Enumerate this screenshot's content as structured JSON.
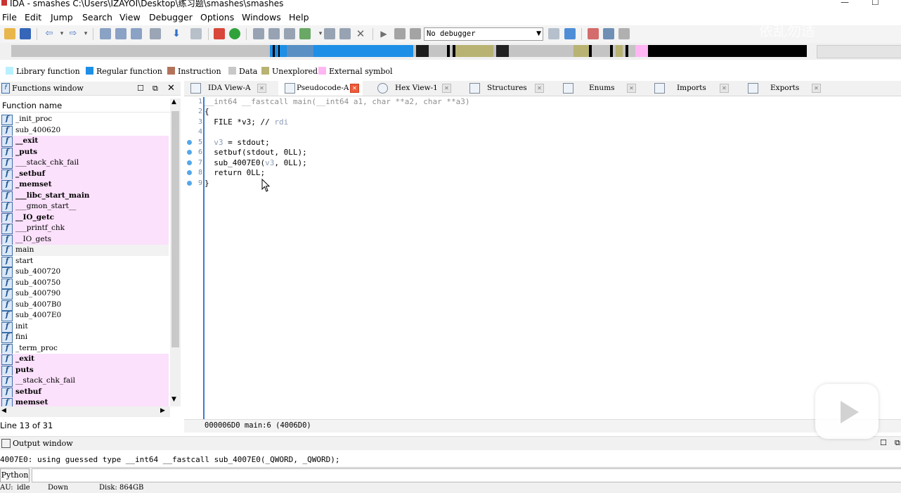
{
  "window": {
    "title": "IDA - smashes C:\\Users\\IZAYOI\\Desktop\\练习题\\smashes\\smashes",
    "min_glyph": "—",
    "max_glyph": "☐"
  },
  "menu": [
    "File",
    "Edit",
    "Jump",
    "Search",
    "View",
    "Debugger",
    "Options",
    "Windows",
    "Help"
  ],
  "toolbar": {
    "debugger_select": "No debugger"
  },
  "legend": [
    {
      "label": "Library function",
      "color": "#b9f0ff"
    },
    {
      "label": "Regular function",
      "color": "#1d8fe6"
    },
    {
      "label": "Instruction",
      "color": "#b3735a"
    },
    {
      "label": "Data",
      "color": "#c8c8c8"
    },
    {
      "label": "Unexplored",
      "color": "#b8b273"
    },
    {
      "label": "External symbol",
      "color": "#ffb6f3"
    }
  ],
  "functions_window": {
    "title": "Functions window",
    "column_header": "Function name",
    "status": "Line 13 of 31",
    "items": [
      {
        "name": "_init_proc",
        "style": "plain"
      },
      {
        "name": "sub_400620",
        "style": "plain"
      },
      {
        "name": "__exit",
        "style": "pink-bold"
      },
      {
        "name": "_puts",
        "style": "pink-bold"
      },
      {
        "name": "___stack_chk_fail",
        "style": "pink"
      },
      {
        "name": "_setbuf",
        "style": "pink-bold"
      },
      {
        "name": "_memset",
        "style": "pink-bold"
      },
      {
        "name": "___libc_start_main",
        "style": "pink-bold"
      },
      {
        "name": "___gmon_start__",
        "style": "pink"
      },
      {
        "name": "__IO_getc",
        "style": "pink-bold"
      },
      {
        "name": "___printf_chk",
        "style": "pink"
      },
      {
        "name": "__IO_gets",
        "style": "pink"
      },
      {
        "name": "main",
        "style": "grey"
      },
      {
        "name": "start",
        "style": "plain"
      },
      {
        "name": "sub_400720",
        "style": "plain"
      },
      {
        "name": "sub_400750",
        "style": "plain"
      },
      {
        "name": "sub_400790",
        "style": "plain"
      },
      {
        "name": "sub_4007B0",
        "style": "plain"
      },
      {
        "name": "sub_4007E0",
        "style": "plain"
      },
      {
        "name": "init",
        "style": "plain"
      },
      {
        "name": "fini",
        "style": "plain"
      },
      {
        "name": "_term_proc",
        "style": "plain"
      },
      {
        "name": "_exit",
        "style": "pink-bold"
      },
      {
        "name": "puts",
        "style": "pink-bold"
      },
      {
        "name": "__stack_chk_fail",
        "style": "pink"
      },
      {
        "name": "setbuf",
        "style": "pink-bold"
      },
      {
        "name": "memset",
        "style": "pink-bold"
      }
    ]
  },
  "tabs": [
    {
      "label": "IDA View-A",
      "active": false
    },
    {
      "label": "Pseudocode-A",
      "active": true
    },
    {
      "label": "Hex View-1",
      "active": false
    },
    {
      "label": "Structures",
      "active": false
    },
    {
      "label": "Enums",
      "active": false
    },
    {
      "label": "Imports",
      "active": false
    },
    {
      "label": "Exports",
      "active": false
    }
  ],
  "code": {
    "line_numbers": [
      "1",
      "2",
      "3",
      "4",
      "5",
      "6",
      "7",
      "8",
      "9"
    ],
    "lines": [
      {
        "text": "__int64 __fastcall main(__int64 a1, char **a2, char **a3)",
        "cls": "cmt"
      },
      {
        "text": "{",
        "cls": ""
      },
      {
        "text": "  FILE *v3; // ",
        "suffix": "rdi",
        "cls": ""
      },
      {
        "text": "",
        "cls": ""
      },
      {
        "text": "  ",
        "prefix_var": "v3",
        "rest": " = stdout;",
        "cls": ""
      },
      {
        "text": "  setbuf(stdout, 0LL);",
        "cls": ""
      },
      {
        "text": "  sub_4007E0(",
        "mid_var": "v3",
        "rest": ", 0LL);",
        "cls": ""
      },
      {
        "text": "  return 0LL;",
        "cls": ""
      },
      {
        "text": "}",
        "cls": ""
      }
    ],
    "breakpoint_lines": [
      "5",
      "6",
      "7",
      "8",
      "9"
    ],
    "address_bar": "000006D0 main:6 (4006D0)"
  },
  "output": {
    "title": "Output window",
    "text": "4007E0: using guessed type __int64 __fastcall sub_4007E0(_QWORD, _QWORD);",
    "python_button": "Python"
  },
  "statusbar": {
    "au": "AU:",
    "state": "idle",
    "direction": "Down",
    "disk": "Disk: 864GB"
  },
  "overlay": {
    "watermark": "依乱勿适"
  }
}
